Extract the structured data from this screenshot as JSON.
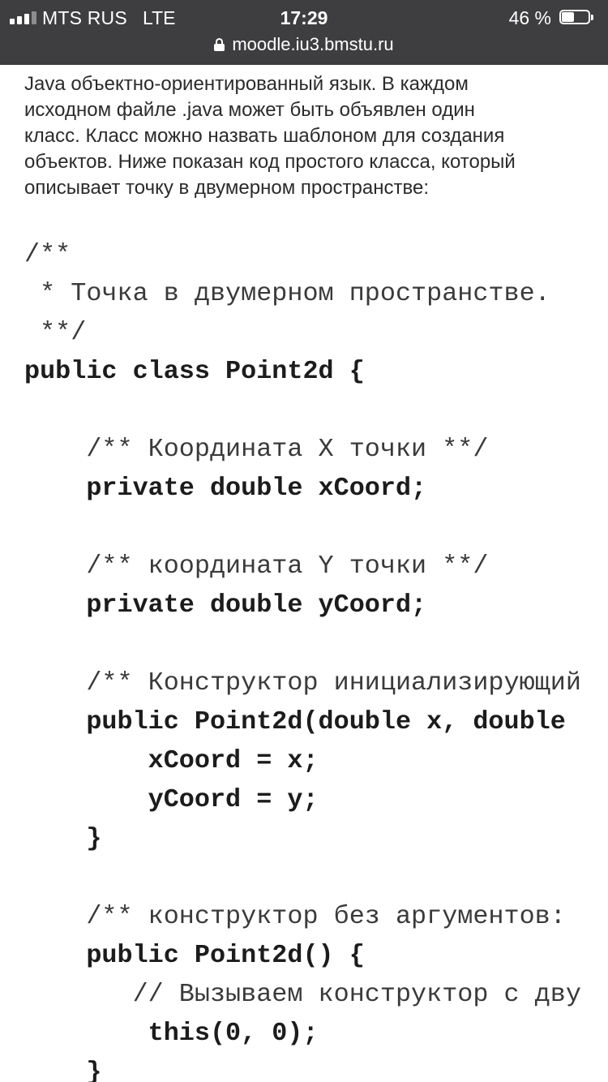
{
  "status_bar": {
    "carrier": "MTS RUS",
    "network": "LTE",
    "time": "17:29",
    "battery_percent": "46 %",
    "battery_level": 0.46,
    "signal_bars_active": 3,
    "signal_bars_total": 4
  },
  "browser": {
    "url": "moodle.iu3.bmstu.ru"
  },
  "article": {
    "intro_lines": [
      "Java объектно-ориентированный язык. В каждом",
      "исходном файле .java  может быть объявлен один",
      "класс. Класс можно назвать шаблоном для создания",
      "объектов. Ниже показан код простого класса, который",
      "описывает точку в двумерном пространстве:"
    ],
    "code_lines": [
      "/**",
      " * Точка в двумерном пространстве.",
      " **/",
      "public class Point2d {",
      "",
      "    /** Координата X точки **/",
      "    private double xCoord;",
      "",
      "    /** координата Y точки **/",
      "    private double yCoord;",
      "",
      "    /** Конструктор инициализирующий",
      "    public Point2d(double x, double",
      "        xCoord = x;",
      "        yCoord = y;",
      "    }",
      "",
      "    /** конструктор без аргументов:",
      "    public Point2d() {",
      "       // Вызываем конструктор с дву",
      "        this(0, 0);",
      "    }"
    ]
  }
}
